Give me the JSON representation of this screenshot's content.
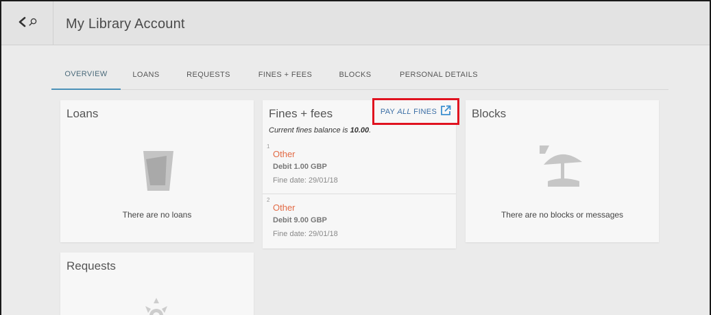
{
  "header": {
    "title": "My Library Account",
    "back_icon": "chevron-left-icon",
    "search_icon": "search-icon"
  },
  "tabs": [
    {
      "label": "OVERVIEW",
      "active": true
    },
    {
      "label": "LOANS",
      "active": false
    },
    {
      "label": "REQUESTS",
      "active": false
    },
    {
      "label": "FINES + FEES",
      "active": false
    },
    {
      "label": "BLOCKS",
      "active": false
    },
    {
      "label": "PERSONAL DETAILS",
      "active": false
    }
  ],
  "loans": {
    "title": "Loans",
    "empty_text": "There are no loans",
    "icon": "cup-icon"
  },
  "fines": {
    "title": "Fines + fees",
    "balance_prefix": "Current fines balance is ",
    "balance_value": "10.00",
    "balance_suffix": ".",
    "pay_prefix": "PAY ",
    "pay_all": "ALL",
    "pay_suffix": " FINES",
    "pay_icon": "external-link-icon",
    "items": [
      {
        "number": "1",
        "type": "Other",
        "debit": "Debit 1.00 GBP",
        "date": "Fine date: 29/01/18"
      },
      {
        "number": "2",
        "type": "Other",
        "debit": "Debit 9.00 GBP",
        "date": "Fine date: 29/01/18"
      }
    ]
  },
  "blocks": {
    "title": "Blocks",
    "empty_text": "There are no blocks or messages",
    "icon": "beach-umbrella-icon"
  },
  "requests": {
    "title": "Requests",
    "icon": "sun-icon"
  },
  "colors": {
    "accent": "#4a90b8",
    "fine_type": "#e26a45",
    "link": "#3b6ea5",
    "highlight": "#e0121f"
  }
}
